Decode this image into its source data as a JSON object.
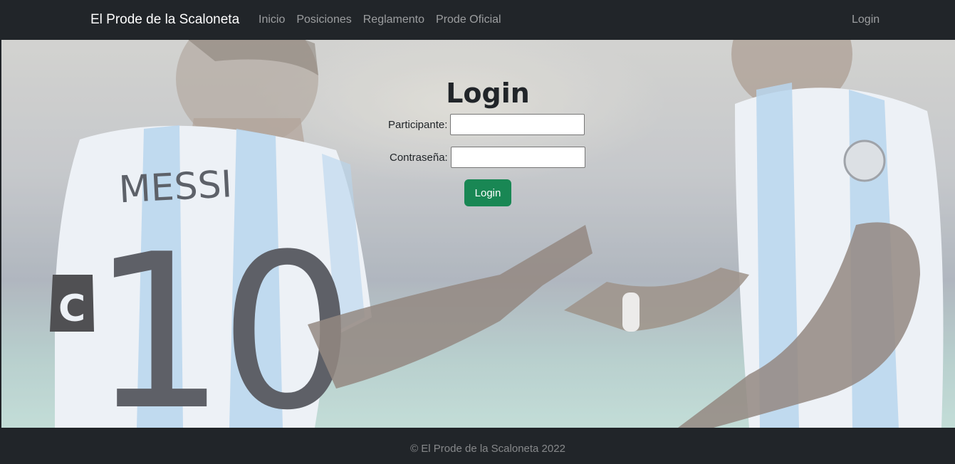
{
  "navbar": {
    "brand": "El Prode de la Scaloneta",
    "links": [
      "Inicio",
      "Posiciones",
      "Reglamento",
      "Prode Oficial"
    ],
    "login": "Login"
  },
  "hero": {
    "jersey_name": "MESSI",
    "jersey_number": "10",
    "captain_band": "C"
  },
  "login_form": {
    "title": "Login",
    "participante_label": "Participante:",
    "participante_value": "",
    "contrasena_label": "Contraseña:",
    "contrasena_value": "",
    "submit_label": "Login"
  },
  "footer": {
    "text": "© El Prode de la Scaloneta 2022"
  },
  "colors": {
    "navbar_bg": "#212529",
    "button_green": "#198754",
    "jersey_blue": "#a9cdea"
  }
}
